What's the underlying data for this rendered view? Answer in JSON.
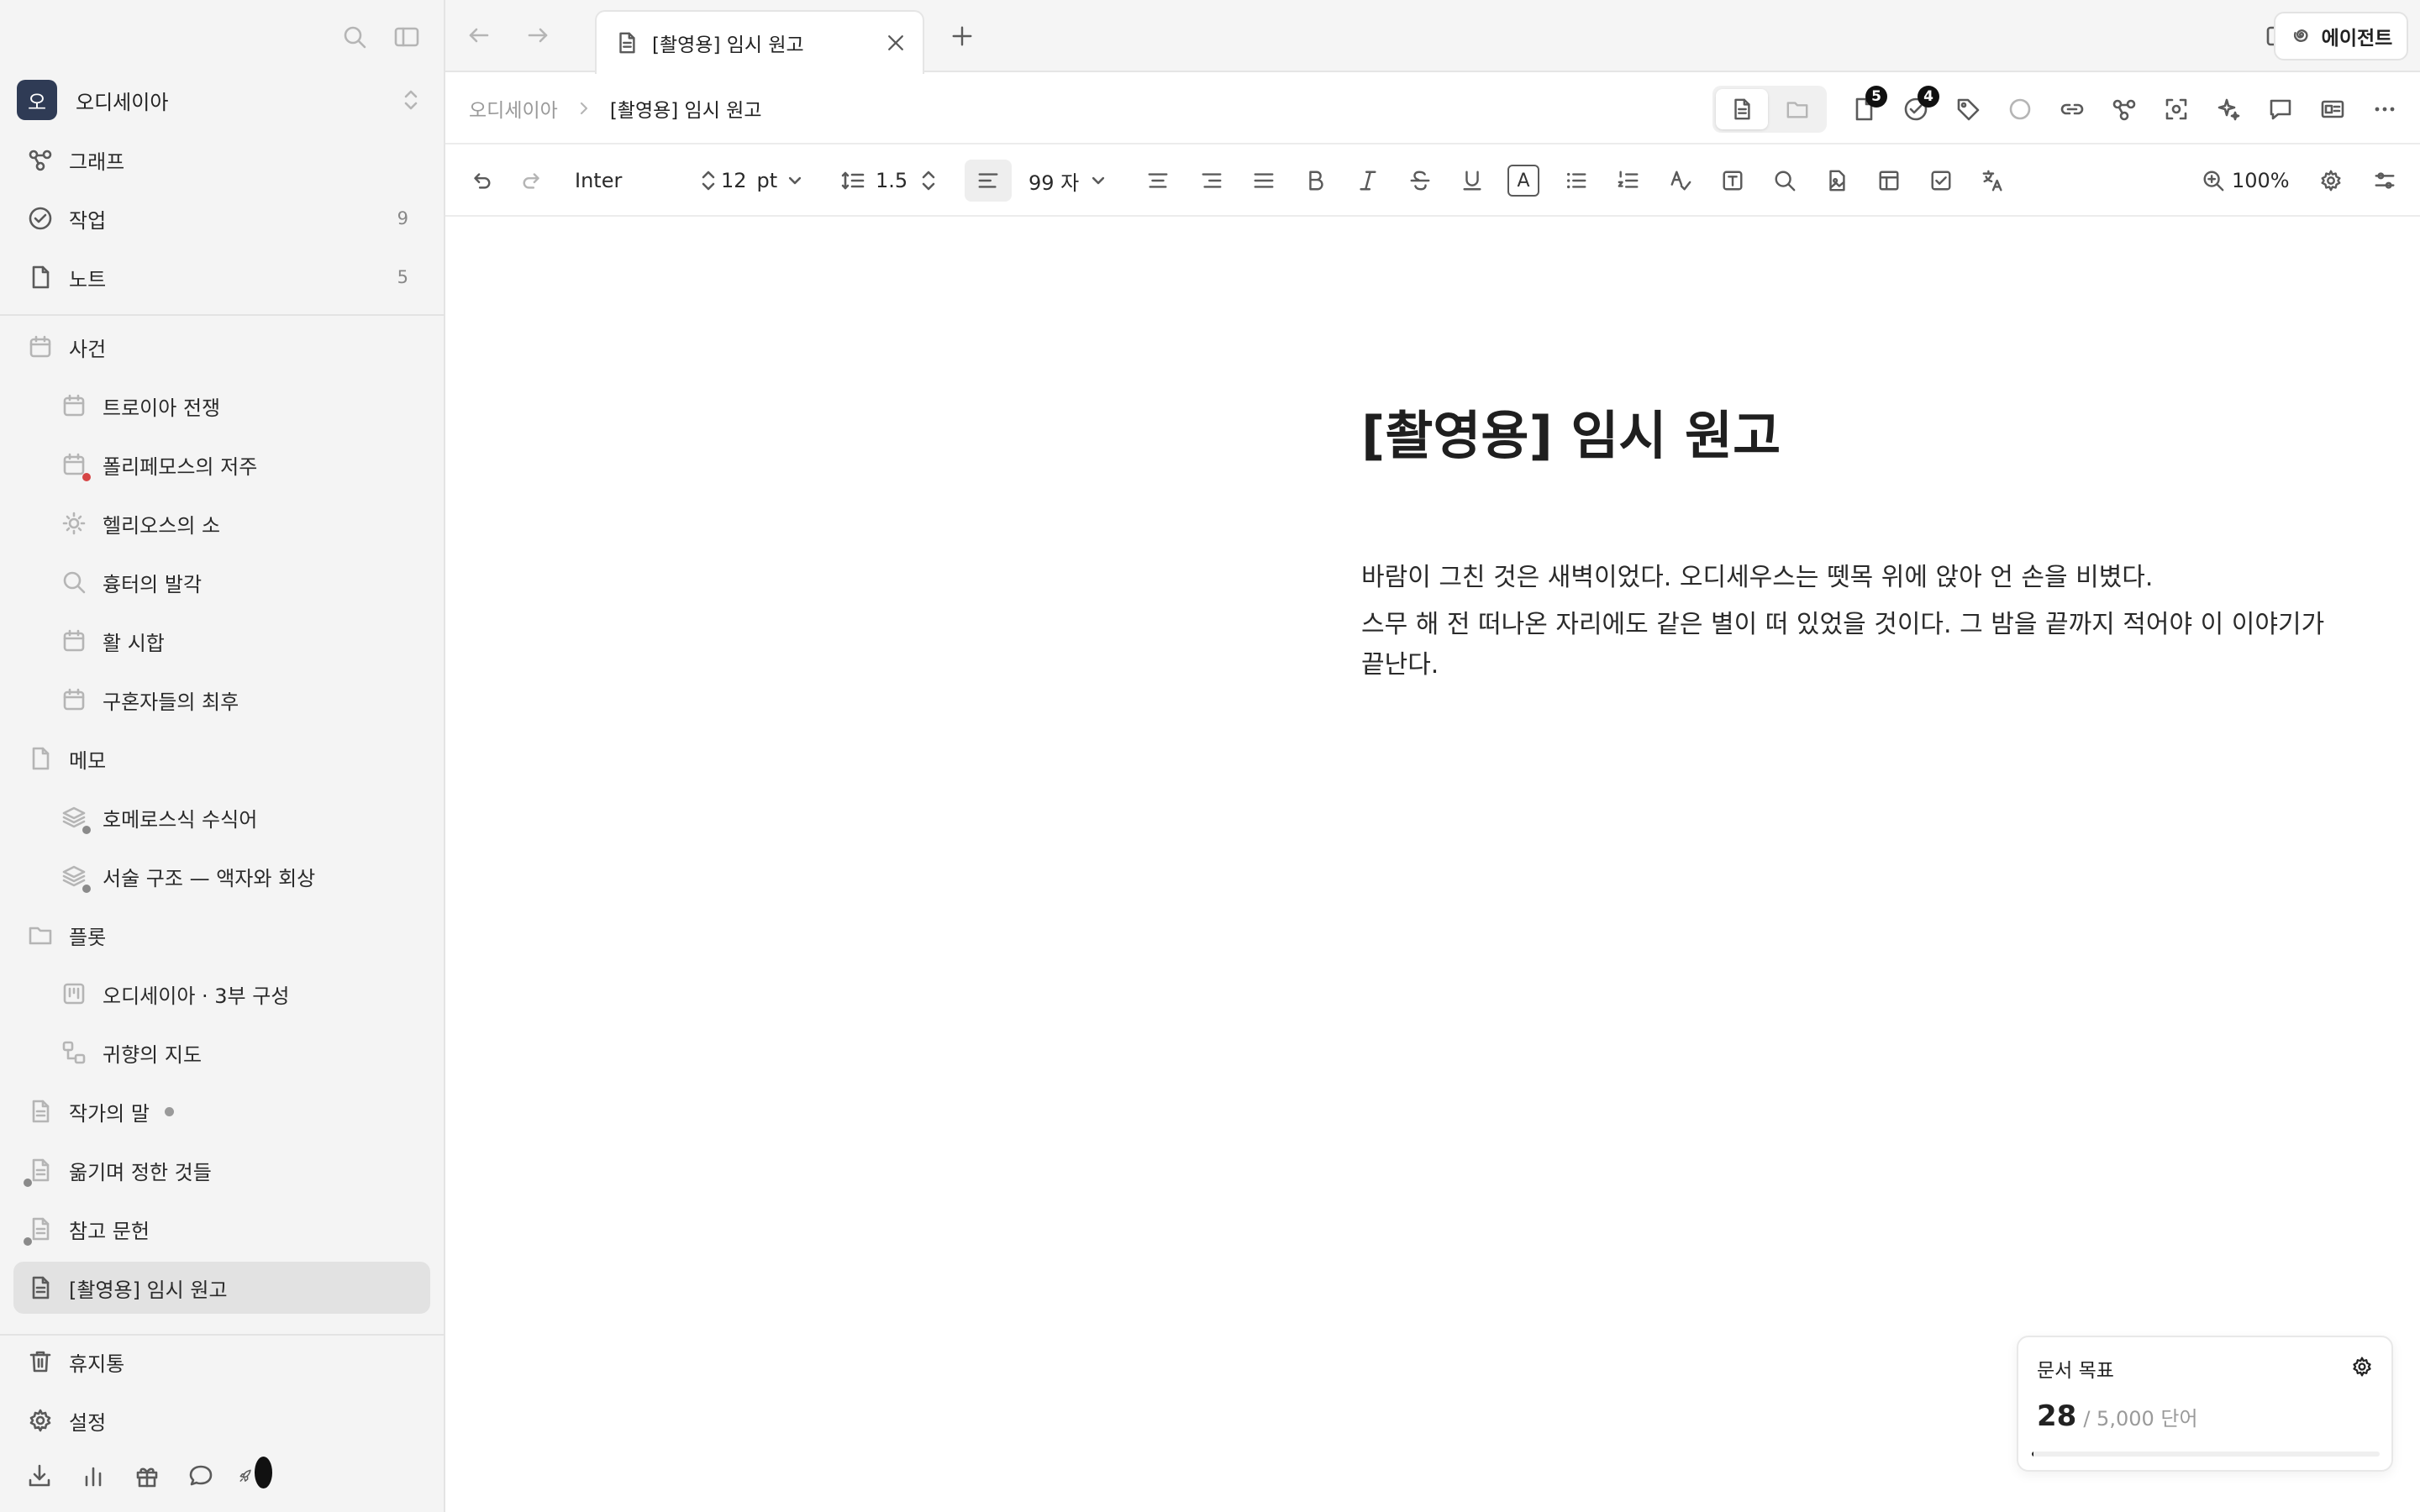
{
  "sidebar": {
    "workspace": {
      "avatar": "오",
      "name": "오디세이아"
    },
    "nav": [
      {
        "label": "그래프",
        "count": ""
      },
      {
        "label": "작업",
        "count": "9"
      },
      {
        "label": "노트",
        "count": "5"
      }
    ],
    "tree": [
      {
        "label": "사건"
      },
      {
        "label": "트로이아 전쟁"
      },
      {
        "label": "폴리페모스의 저주"
      },
      {
        "label": "헬리오스의 소"
      },
      {
        "label": "흉터의 발각"
      },
      {
        "label": "활 시합"
      },
      {
        "label": "구혼자들의 최후"
      },
      {
        "label": "메모"
      },
      {
        "label": "호메로스식 수식어"
      },
      {
        "label": "서술 구조 — 액자와 회상"
      },
      {
        "label": "플롯"
      },
      {
        "label": "오디세이아 · 3부 구성"
      },
      {
        "label": "귀향의 지도"
      },
      {
        "label": "작가의 말"
      },
      {
        "label": "옮기며 정한 것들"
      },
      {
        "label": "참고 문헌"
      },
      {
        "label": "[촬영용] 임시 원고"
      }
    ],
    "footer": [
      {
        "label": "휴지통"
      },
      {
        "label": "설정"
      }
    ]
  },
  "tabbar": {
    "tab_label": "[촬영용] 임시 원고",
    "agent_label": "에이전트"
  },
  "breadcrumb": {
    "root": "오디세이아",
    "current": "[촬영용] 임시 원고",
    "badges": {
      "documents": "5",
      "tasks": "4"
    }
  },
  "toolbar": {
    "font": "Inter",
    "size": "12",
    "size_unit": "pt",
    "line_height": "1.5",
    "char_count": "99 자",
    "zoom": "100%"
  },
  "document": {
    "title": "[촬영용] 임시 원고",
    "paragraphs": [
      "바람이 그친 것은 새벽이었다. 오디세우스는 뗏목 위에 앉아 언 손을 비볐다.",
      "스무 해 전 떠나온 자리에도 같은 별이 떠 있었을 것이다. 그 밤을 끝까지 적어야 이 이야기가 끝난다."
    ]
  },
  "goal": {
    "title": "문서 목표",
    "current": "28",
    "target": "/ 5,000 단어",
    "progress": 0.0056
  },
  "colors": {
    "accent_dark": "#2f3b55",
    "red_dot": "#d64545",
    "active_row": "#e2e2e2"
  }
}
